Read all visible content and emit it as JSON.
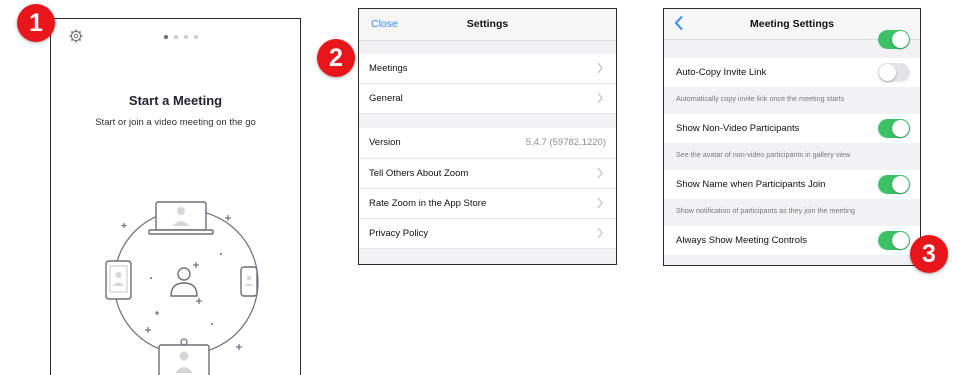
{
  "panel1": {
    "title": "Start a Meeting",
    "subtitle": "Start or join a video meeting on the go",
    "pager_dots": 4,
    "active_dot": 1,
    "icons": [
      "gear-icon",
      "laptop-icon",
      "tablet-icon",
      "phone-icon",
      "user-icon",
      "room-system-icon"
    ]
  },
  "panel2": {
    "nav": {
      "left": "Close",
      "title": "Settings"
    },
    "group1": [
      {
        "label": "Meetings"
      },
      {
        "label": "General"
      }
    ],
    "group2": [
      {
        "label": "Version",
        "value": "5.4.7 (59782.1220)"
      },
      {
        "label": "Tell Others About Zoom"
      },
      {
        "label": "Rate Zoom in the App Store"
      },
      {
        "label": "Privacy Policy"
      }
    ]
  },
  "panel3": {
    "nav": {
      "title": "Meeting Settings",
      "back_icon": "chevron-left-icon"
    },
    "settings": [
      {
        "label": "Auto-Copy Invite Link",
        "on": false,
        "desc": "Automatically copy invite link once the meeting starts"
      },
      {
        "label": "Show Non-Video Participants",
        "on": true,
        "desc": "See the avatar of non-video participants in gallery view"
      },
      {
        "label": "Show Name when Participants Join",
        "on": true,
        "desc": "Show notification of participants as they join the meeting"
      },
      {
        "label": "Always Show Meeting Controls",
        "on": true
      }
    ]
  },
  "badges": [
    "1",
    "2",
    "3"
  ],
  "colors": {
    "accent": "#2d8cff",
    "toggle_on": "#3cc166",
    "badge": "#e8151a"
  }
}
